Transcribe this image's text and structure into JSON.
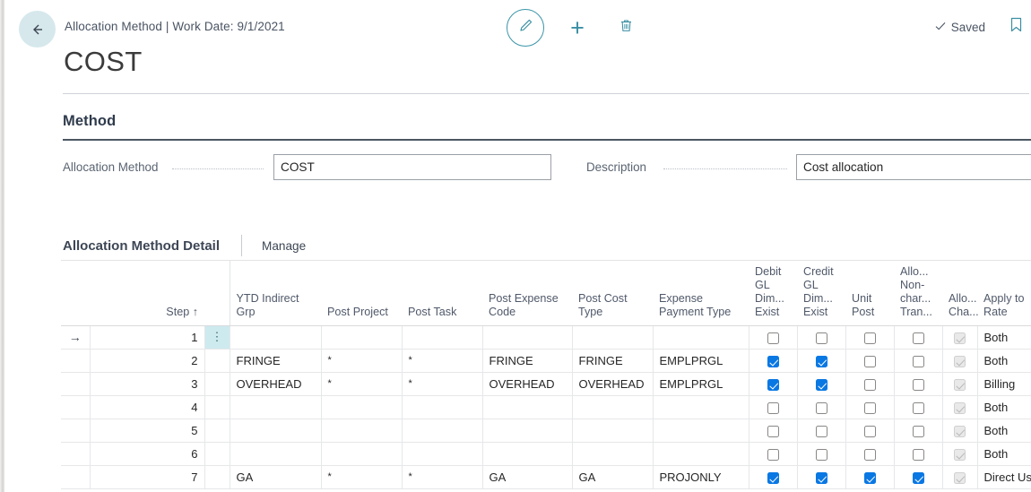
{
  "header": {
    "back_icon": "arrow-left-icon",
    "breadcrumb": "Allocation Method | Work Date: 9/1/2021",
    "page_title": "COST",
    "edit_icon": "pencil-icon",
    "new_icon": "plus-icon",
    "delete_icon": "trash-icon",
    "saved_label": "Saved",
    "saved_check_icon": "check-icon",
    "bookmark_icon": "bookmark-icon"
  },
  "method_section": {
    "title": "Method",
    "allocation_method_label": "Allocation Method",
    "allocation_method_value": "COST",
    "description_label": "Description",
    "description_value": "Cost allocation"
  },
  "detail_section": {
    "title": "Allocation Method Detail",
    "manage_label": "Manage"
  },
  "grid": {
    "columns": [
      {
        "key": "indicator",
        "label": ""
      },
      {
        "key": "step",
        "label": "Step ↑"
      },
      {
        "key": "menu",
        "label": ""
      },
      {
        "key": "ytd_indirect_grp",
        "label": "YTD Indirect Grp"
      },
      {
        "key": "post_project",
        "label": "Post Project"
      },
      {
        "key": "post_task",
        "label": "Post Task"
      },
      {
        "key": "post_expense_code",
        "label": "Post Expense Code"
      },
      {
        "key": "post_cost_type",
        "label": "Post Cost Type"
      },
      {
        "key": "expense_payment_type",
        "label": "Expense Payment Type"
      },
      {
        "key": "debit_gl_dim_exist",
        "label": "Debit GL Dim... Exist"
      },
      {
        "key": "credit_gl_dim_exist",
        "label": "Credit GL Dim... Exist"
      },
      {
        "key": "unit_post",
        "label": "Unit Post"
      },
      {
        "key": "allo_non_char_tran",
        "label": "Allo... Non- char... Tran..."
      },
      {
        "key": "allo_cha",
        "label": "Allo... Cha..."
      },
      {
        "key": "apply_to_rate",
        "label": "Apply to Rate"
      }
    ],
    "selected_row_index": 0,
    "menu_glyph": "⋮",
    "indicator_glyph": "→",
    "rows": [
      {
        "step": "1",
        "ytd_indirect_grp": "",
        "post_project": "",
        "post_task": "",
        "post_expense_code": "",
        "post_cost_type": "",
        "expense_payment_type": "",
        "debit_gl_dim_exist": false,
        "credit_gl_dim_exist": false,
        "unit_post": false,
        "allo_non_char_tran": false,
        "allo_cha": "disabled-checked",
        "apply_to_rate": "Both"
      },
      {
        "step": "2",
        "ytd_indirect_grp": "FRINGE",
        "post_project": "*",
        "post_task": "*",
        "post_expense_code": "FRINGE",
        "post_cost_type": "FRINGE",
        "expense_payment_type": "EMPLPRGL",
        "debit_gl_dim_exist": true,
        "credit_gl_dim_exist": true,
        "unit_post": false,
        "allo_non_char_tran": false,
        "allo_cha": "disabled-checked",
        "apply_to_rate": "Both"
      },
      {
        "step": "3",
        "ytd_indirect_grp": "OVERHEAD",
        "post_project": "*",
        "post_task": "*",
        "post_expense_code": "OVERHEAD",
        "post_cost_type": "OVERHEAD",
        "expense_payment_type": "EMPLPRGL",
        "debit_gl_dim_exist": true,
        "credit_gl_dim_exist": true,
        "unit_post": false,
        "allo_non_char_tran": false,
        "allo_cha": "disabled-checked",
        "apply_to_rate": "Billing"
      },
      {
        "step": "4",
        "ytd_indirect_grp": "",
        "post_project": "",
        "post_task": "",
        "post_expense_code": "",
        "post_cost_type": "",
        "expense_payment_type": "",
        "debit_gl_dim_exist": false,
        "credit_gl_dim_exist": false,
        "unit_post": false,
        "allo_non_char_tran": false,
        "allo_cha": "disabled-checked",
        "apply_to_rate": "Both"
      },
      {
        "step": "5",
        "ytd_indirect_grp": "",
        "post_project": "",
        "post_task": "",
        "post_expense_code": "",
        "post_cost_type": "",
        "expense_payment_type": "",
        "debit_gl_dim_exist": false,
        "credit_gl_dim_exist": false,
        "unit_post": false,
        "allo_non_char_tran": false,
        "allo_cha": "disabled-checked",
        "apply_to_rate": "Both"
      },
      {
        "step": "6",
        "ytd_indirect_grp": "",
        "post_project": "",
        "post_task": "",
        "post_expense_code": "",
        "post_cost_type": "",
        "expense_payment_type": "",
        "debit_gl_dim_exist": false,
        "credit_gl_dim_exist": false,
        "unit_post": false,
        "allo_non_char_tran": false,
        "allo_cha": "disabled-checked",
        "apply_to_rate": "Both"
      },
      {
        "step": "7",
        "ytd_indirect_grp": "GA",
        "post_project": "*",
        "post_task": "*",
        "post_expense_code": "GA",
        "post_cost_type": "GA",
        "expense_payment_type": "PROJONLY",
        "debit_gl_dim_exist": true,
        "credit_gl_dim_exist": true,
        "unit_post": true,
        "allo_non_char_tran": true,
        "allo_cha": "disabled-checked",
        "apply_to_rate": "Direct Usage"
      }
    ]
  },
  "colors": {
    "accent_teal": "#3a8fa3",
    "selection_cyan": "#cdeaef",
    "checkbox_blue": "#0a78e3",
    "rule_dark": "#4c5663"
  }
}
